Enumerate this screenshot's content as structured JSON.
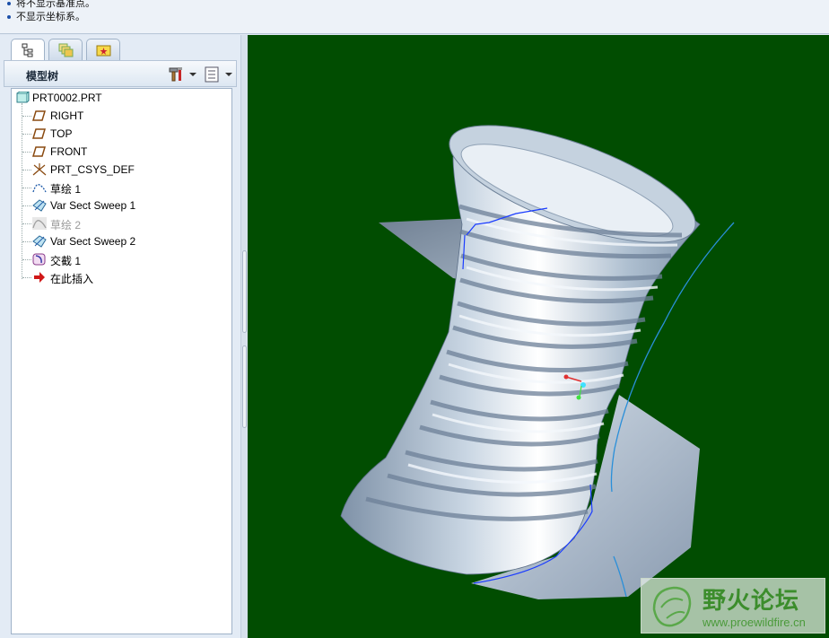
{
  "messages": [
    "将不显示基准点。",
    "不显示坐标系。"
  ],
  "model_tree": {
    "title": "模型树",
    "tabs": [
      "model-tree-tab",
      "layer-tab",
      "favorites-tab"
    ],
    "items": [
      {
        "label": "PRT0002.PRT",
        "icon": "part-icon",
        "dim": false
      },
      {
        "label": "RIGHT",
        "icon": "datum-plane-icon",
        "dim": false
      },
      {
        "label": "TOP",
        "icon": "datum-plane-icon",
        "dim": false
      },
      {
        "label": "FRONT",
        "icon": "datum-plane-icon",
        "dim": false
      },
      {
        "label": "PRT_CSYS_DEF",
        "icon": "csys-icon",
        "dim": false
      },
      {
        "label": "草绘 1",
        "icon": "sketch-icon",
        "dim": false
      },
      {
        "label": "Var Sect Sweep 1",
        "icon": "sweep-icon",
        "dim": false
      },
      {
        "label": "草绘 2",
        "icon": "sketch-icon",
        "dim": true
      },
      {
        "label": "Var Sect Sweep 2",
        "icon": "sweep-icon",
        "dim": false
      },
      {
        "label": "交截 1",
        "icon": "intersect-icon",
        "dim": false
      },
      {
        "label": "在此插入",
        "icon": "insert-here-icon",
        "dim": false
      }
    ]
  },
  "watermark": {
    "title": "野火论坛",
    "url": "www.proewildfire.cn"
  },
  "colors": {
    "viewport_background": "#014d01",
    "surface": "#aebfd0",
    "curve": "#2a8fd9"
  }
}
